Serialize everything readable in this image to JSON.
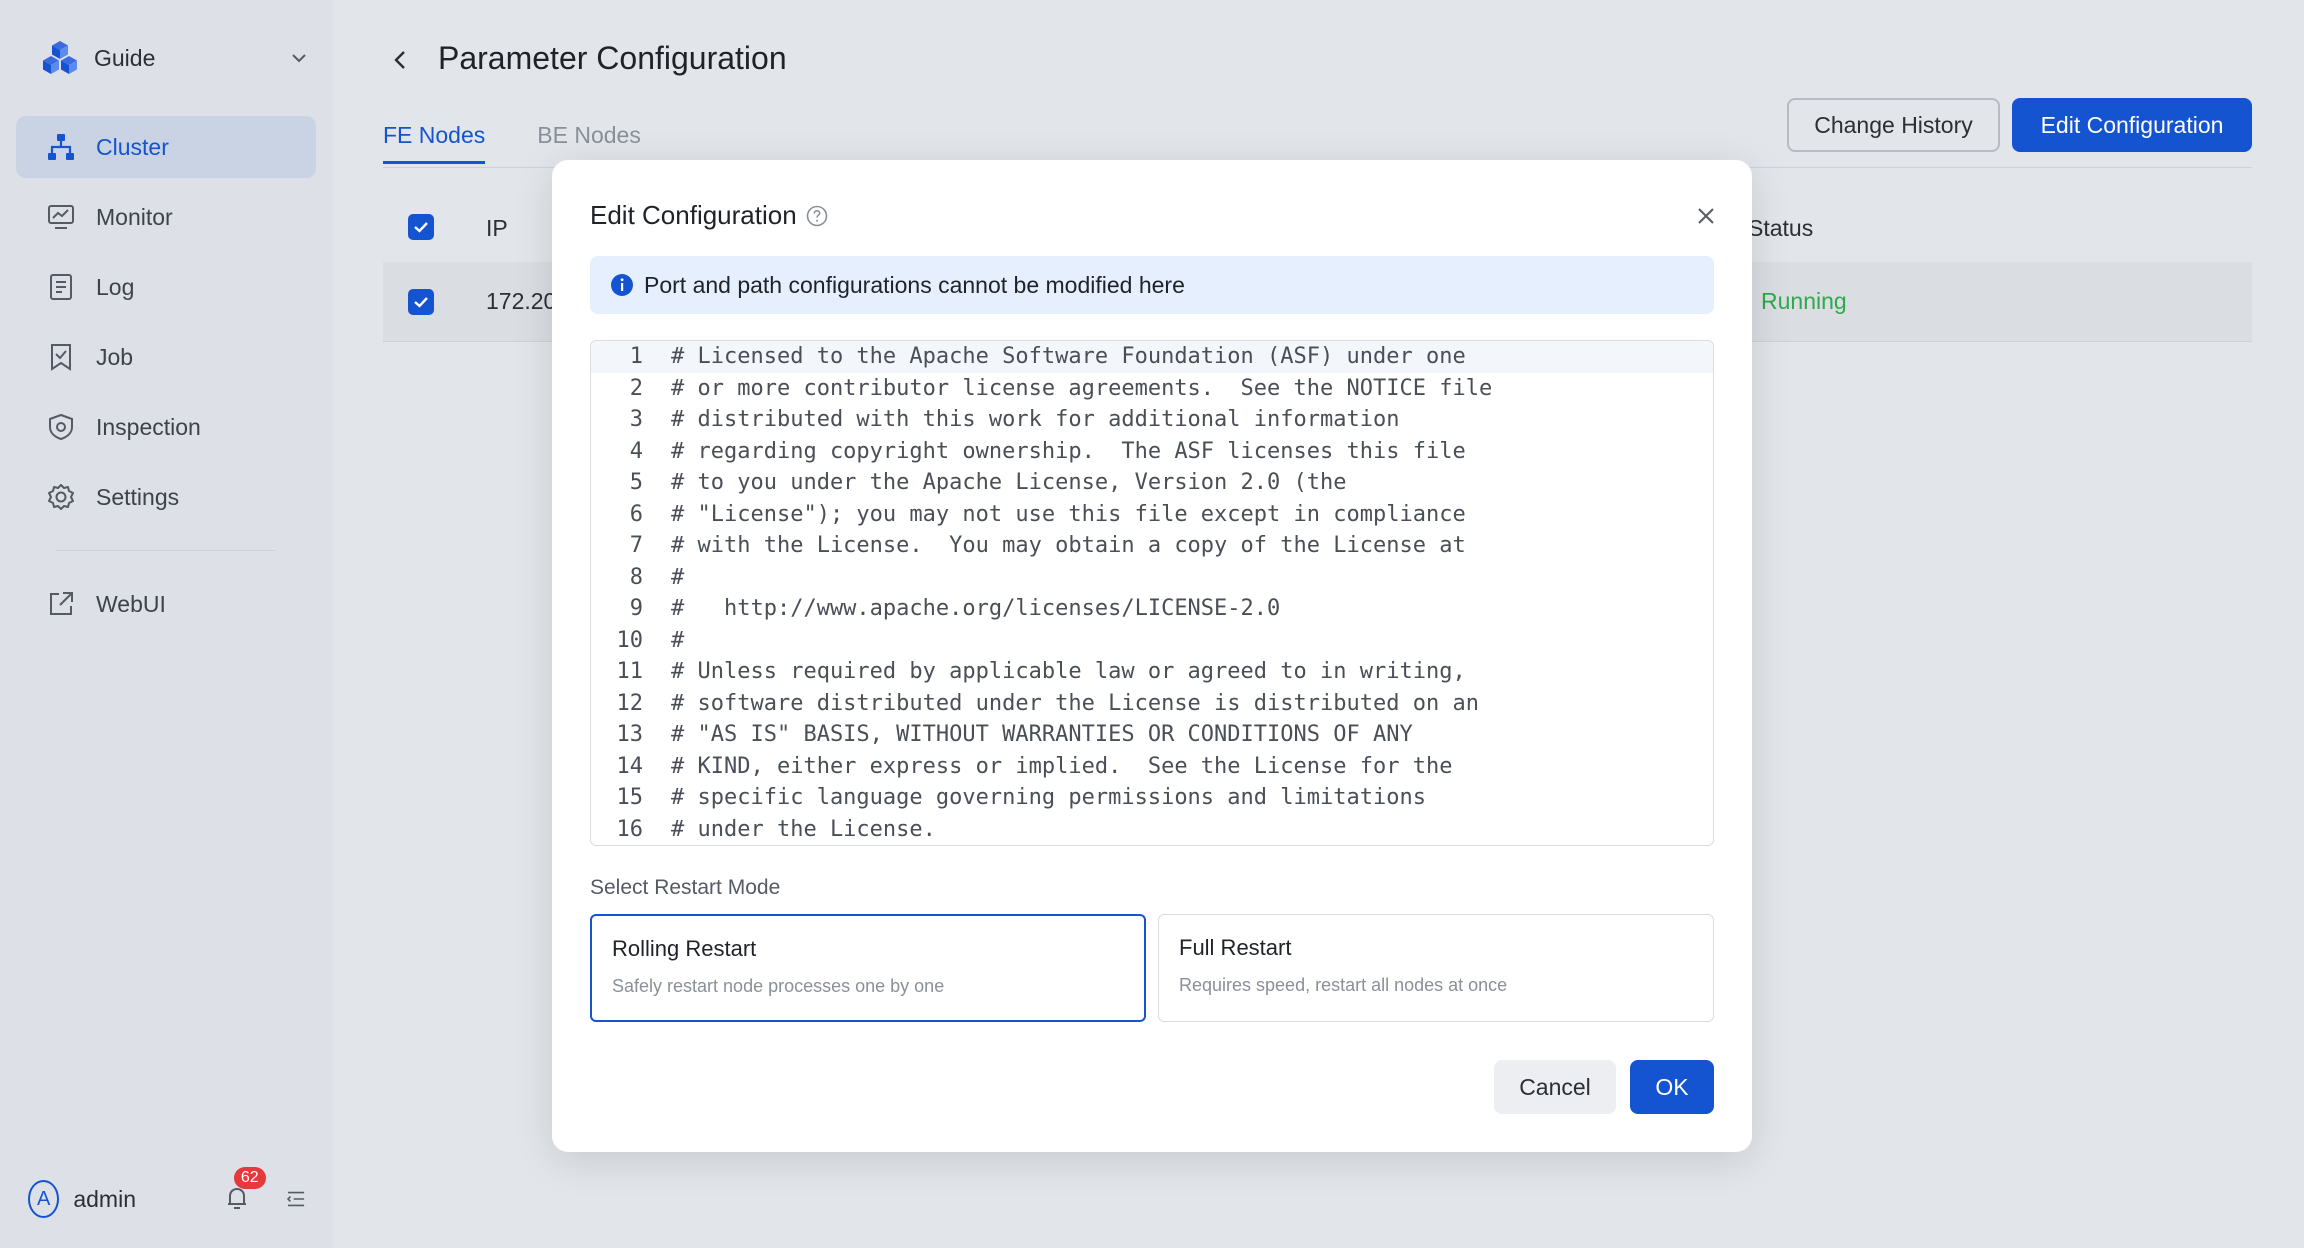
{
  "sidebar": {
    "brand": "Guide",
    "items": [
      {
        "label": "Cluster",
        "icon": "cluster-icon",
        "active": true
      },
      {
        "label": "Monitor",
        "icon": "monitor-icon"
      },
      {
        "label": "Log",
        "icon": "log-icon"
      },
      {
        "label": "Job",
        "icon": "job-icon"
      },
      {
        "label": "Inspection",
        "icon": "inspection-icon"
      },
      {
        "label": "Settings",
        "icon": "settings-icon"
      }
    ],
    "external": {
      "label": "WebUI",
      "icon": "external-link-icon"
    },
    "user": {
      "avatar": "A",
      "name": "admin",
      "notifications": "62"
    }
  },
  "page": {
    "title": "Parameter Configuration",
    "tabs": [
      "FE Nodes",
      "BE Nodes"
    ],
    "active_tab": "FE Nodes",
    "buttons": {
      "history": "Change History",
      "edit": "Edit Configuration"
    }
  },
  "table": {
    "headers": {
      "ip": "IP",
      "status": "Status"
    },
    "rows": [
      {
        "ip": "172.20",
        "status": "Running"
      }
    ]
  },
  "modal": {
    "title": "Edit Configuration",
    "alert": "Port and path configurations cannot be modified here",
    "code_lines": [
      "# Licensed to the Apache Software Foundation (ASF) under one",
      "# or more contributor license agreements.  See the NOTICE file",
      "# distributed with this work for additional information",
      "# regarding copyright ownership.  The ASF licenses this file",
      "# to you under the Apache License, Version 2.0 (the",
      "# \"License\"); you may not use this file except in compliance",
      "# with the License.  You may obtain a copy of the License at",
      "#",
      "#   http://www.apache.org/licenses/LICENSE-2.0",
      "#",
      "# Unless required by applicable law or agreed to in writing,",
      "# software distributed under the License is distributed on an",
      "# \"AS IS\" BASIS, WITHOUT WARRANTIES OR CONDITIONS OF ANY",
      "# KIND, either express or implied.  See the License for the",
      "# specific language governing permissions and limitations",
      "# under the License."
    ],
    "restart_label": "Select Restart Mode",
    "options": [
      {
        "title": "Rolling Restart",
        "desc": "Safely restart node processes one by one",
        "selected": true
      },
      {
        "title": "Full Restart",
        "desc": "Requires speed, restart all nodes at once",
        "selected": false
      }
    ],
    "cancel": "Cancel",
    "ok": "OK"
  },
  "colors": {
    "primary": "#1554d1",
    "success": "#2eaa49",
    "badge": "#e5393b"
  }
}
